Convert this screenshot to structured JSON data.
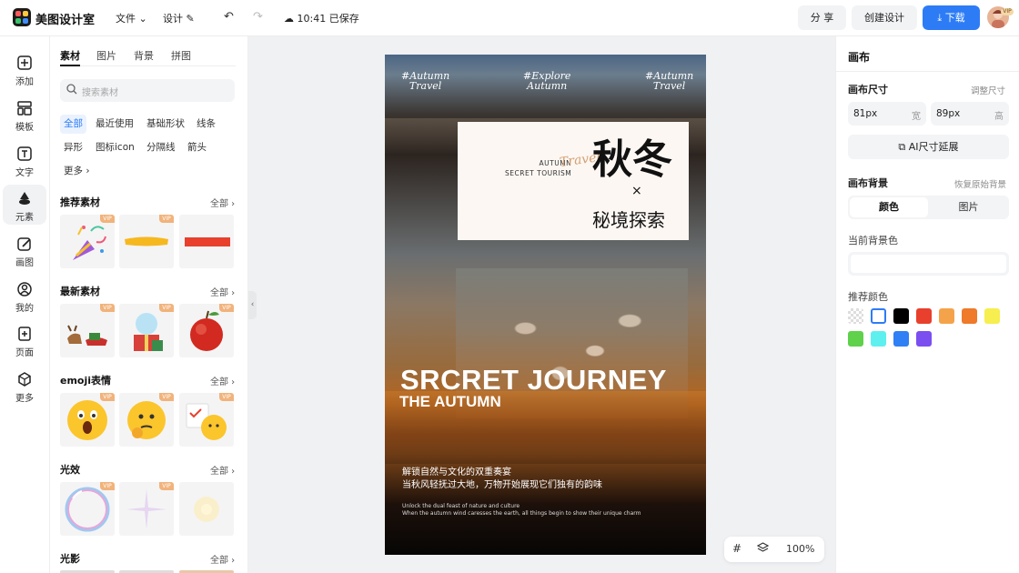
{
  "app": {
    "brand": "美图设计室",
    "menu_file": "文件",
    "menu_design": "设计",
    "save_status": "10:41 已保存",
    "share_label": "分 享",
    "create_label": "创建设计",
    "download_label": "下载",
    "avatar_badge": "VIP"
  },
  "rail": [
    {
      "label": "添加",
      "icon": "plus-square-icon"
    },
    {
      "label": "模板",
      "icon": "template-icon"
    },
    {
      "label": "文字",
      "icon": "text-icon"
    },
    {
      "label": "元素",
      "icon": "shapes-icon"
    },
    {
      "label": "画图",
      "icon": "draw-icon"
    },
    {
      "label": "我的",
      "icon": "user-icon"
    },
    {
      "label": "页面",
      "icon": "page-icon"
    },
    {
      "label": "更多",
      "icon": "cube-icon"
    }
  ],
  "panel": {
    "tabs": [
      "素材",
      "图片",
      "背景",
      "拼图"
    ],
    "search_placeholder": "搜索素材",
    "chips": [
      "全部",
      "最近使用",
      "基础形状",
      "线条",
      "异形",
      "图标icon",
      "分隔线",
      "箭头",
      "更多"
    ],
    "vip": "VIP",
    "sections": [
      {
        "title": "推荐素材",
        "more": "全部"
      },
      {
        "title": "最新素材",
        "more": "全部"
      },
      {
        "title": "emoji表情",
        "more": "全部"
      },
      {
        "title": "光效",
        "more": "全部"
      },
      {
        "title": "光影",
        "more": "全部"
      }
    ]
  },
  "poster": {
    "tag_left": "#Autumn\nTravel",
    "tag_mid": "#Explore\nAutumn",
    "tag_right": "#Autumn\nTravel",
    "card_en": "AUTUMN\nSECRET TOURISM",
    "card_script": "Travel",
    "card_big": "秋冬",
    "card_x": "×",
    "card_sub": "秘境探索",
    "title": "SRCRET JOURNEY",
    "subtitle": "THE AUTUMN",
    "cn_line1": "解锁自然与文化的双重奏宴",
    "cn_line2": "当秋风轻抚过大地，万物开始展现它们独有的韵味",
    "en_line1": "Unlock the dual feast of nature and culture",
    "en_line2": "When the autumn wind caresses the earth, all things begin to show their unique charm"
  },
  "zoom": {
    "value": "100%"
  },
  "right": {
    "title": "画布",
    "size_label": "画布尺寸",
    "size_link": "调整尺寸",
    "width_value": "81px",
    "width_unit": "宽",
    "height_value": "89px",
    "height_unit": "高",
    "ai_button": "AI尺寸延展",
    "bg_label": "画布背景",
    "bg_reset": "恢复原始背景",
    "seg_color": "颜色",
    "seg_image": "图片",
    "current_label": "当前背景色",
    "recommend_label": "推荐颜色",
    "swatches": [
      "transparent",
      "#ffffff",
      "#000000",
      "#e8402d",
      "#f5a34a",
      "#ee7a2a",
      "#f7ee4f",
      "#5fd14b",
      "#5ef0ef",
      "#2f7ff5",
      "#7b4ef0"
    ]
  }
}
